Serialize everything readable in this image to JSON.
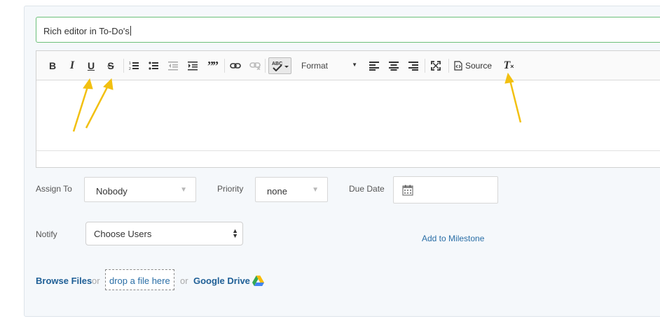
{
  "todo": {
    "title_value": "Rich editor in To-Do's"
  },
  "editor": {
    "toolbar": {
      "bold": "B",
      "italic": "I",
      "underline": "U",
      "strike": "S",
      "blockquote": "99",
      "format_label": "Format",
      "source_label": "Source",
      "remove_format": "T"
    },
    "icons": [
      "bold-icon",
      "italic-icon",
      "underline-icon",
      "strikethrough-icon",
      "numbered-list-icon",
      "bulleted-list-icon",
      "outdent-icon",
      "indent-icon",
      "blockquote-icon",
      "link-icon",
      "unlink-icon",
      "spellcheck-icon",
      "align-left-icon",
      "align-center-icon",
      "align-right-icon",
      "maximize-icon",
      "source-icon",
      "remove-format-icon"
    ]
  },
  "fields": {
    "assign_to_label": "Assign To",
    "assign_to_value": "Nobody",
    "priority_label": "Priority",
    "priority_value": "none",
    "due_date_label": "Due Date",
    "notify_label": "Notify",
    "notify_value": "Choose Users",
    "milestone_link": "Add to Milestone"
  },
  "files": {
    "browse": "Browse Files",
    "or_1": "or",
    "drop": "drop a file here",
    "or_2": "or",
    "google_drive": "Google Drive"
  },
  "colors": {
    "accent_border": "#6cc07a",
    "link": "#2a6ea6",
    "annotation_arrow": "#f5c518"
  }
}
